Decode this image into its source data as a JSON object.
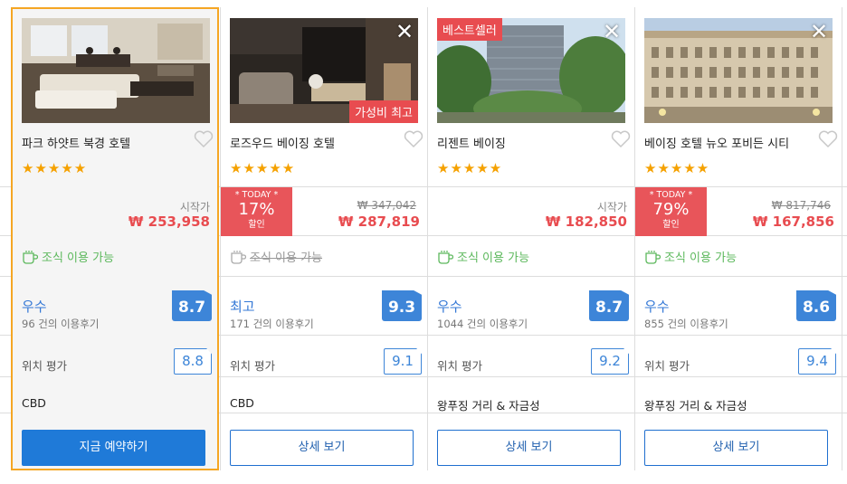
{
  "hotels": [
    {
      "name": "파크 하얏트 북경 호텔",
      "stars": "★★★★★",
      "price_label": "시작가",
      "price": "₩ 253,958",
      "breakfast": "조식 이용 가능",
      "breakfast_available": true,
      "rating_word": "우수",
      "reviews": "96 건의 이용후기",
      "score": "8.7",
      "location_label": "위치 평가",
      "location_score": "8.8",
      "area": "CBD",
      "button": "지금 예약하기",
      "selected": true
    },
    {
      "name": "로즈우드 베이징 호텔",
      "stars": "★★★★★",
      "photo_badge": "가성비 최고",
      "discount_top": "* TODAY *",
      "discount_pct": "17%",
      "discount_sub": "할인",
      "old_price": "₩ 347,042",
      "price": "₩ 287,819",
      "breakfast": "조식 이용 가능",
      "breakfast_available": false,
      "rating_word": "최고",
      "reviews": "171 건의 이용후기",
      "score": "9.3",
      "location_label": "위치 평가",
      "location_score": "9.1",
      "area": "CBD",
      "button": "상세 보기",
      "close": "✕"
    },
    {
      "name": "리젠트 베이징",
      "stars": "★★★★★",
      "photo_badge": "베스트셀러",
      "price_label": "시작가",
      "price": "₩ 182,850",
      "breakfast": "조식 이용 가능",
      "breakfast_available": true,
      "rating_word": "우수",
      "reviews": "1044 건의 이용후기",
      "score": "8.7",
      "location_label": "위치 평가",
      "location_score": "9.2",
      "area": "왕푸징 거리 & 자금성",
      "button": "상세 보기",
      "close": "✕"
    },
    {
      "name": "베이징 호텔 뉴오 포비든 시티",
      "stars": "★★★★★",
      "discount_top": "* TODAY *",
      "discount_pct": "79%",
      "discount_sub": "할인",
      "old_price": "₩ 817,746",
      "price": "₩ 167,856",
      "breakfast": "조식 이용 가능",
      "breakfast_available": true,
      "rating_word": "우수",
      "reviews": "855 건의 이용후기",
      "score": "8.6",
      "location_label": "위치 평가",
      "location_score": "9.4",
      "area": "왕푸징 거리 & 자금성",
      "button": "상세 보기",
      "close": "✕"
    }
  ],
  "colors": {
    "accent_blue": "#1f7ad8",
    "price_red": "#e84c50",
    "star_orange": "#f5a100",
    "breakfast_green": "#5cb85c",
    "selected_border": "#f5a623"
  }
}
